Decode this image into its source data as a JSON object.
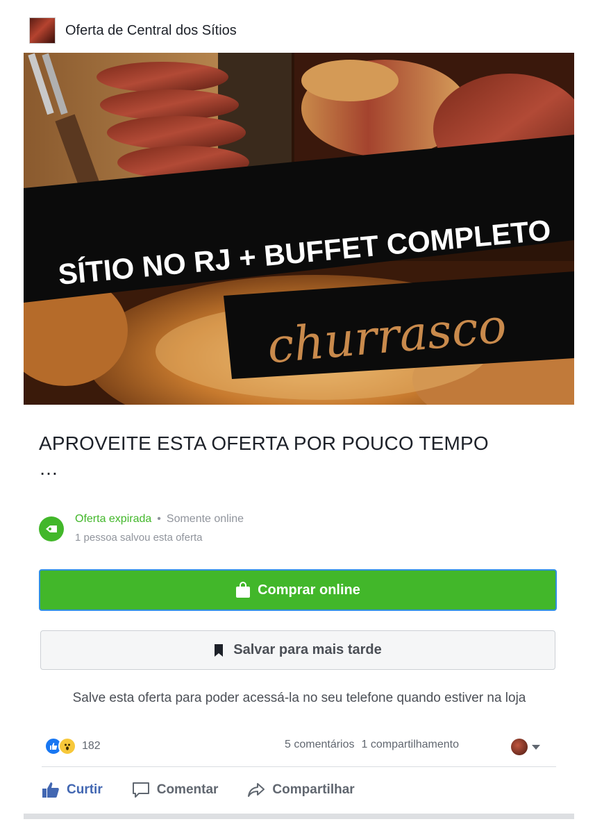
{
  "header": {
    "page_name": "Oferta de Central dos Sítios"
  },
  "hero": {
    "banner_text": "SÍTIO NO RJ + BUFFET COMPLETO",
    "script_text": "churrasco"
  },
  "offer": {
    "title": "APROVEITE ESTA OFERTA POR POUCO TEMPO",
    "title_ellipsis": "…",
    "status_expired": "Oferta expirada",
    "status_dot": "•",
    "status_scope": "Somente online",
    "saved_count": "1 pessoa salvou esta oferta"
  },
  "buttons": {
    "buy_label": "Comprar online",
    "save_label": "Salvar para mais tarde"
  },
  "hint": "Salve esta oferta para poder acessá-la no seu telefone quando estiver na loja",
  "engagement": {
    "reaction_count": "182",
    "comments": "5 comentários",
    "shares": "1 compartilhamento"
  },
  "actions": {
    "like": "Curtir",
    "comment": "Comentar",
    "share": "Compartilhar"
  },
  "colors": {
    "green": "#42b72a",
    "blue": "#4267b2",
    "brand_blue": "#1877f2"
  },
  "icons": [
    "shopping-bag-icon",
    "bookmark-icon",
    "offer-tag-icon",
    "like-icon",
    "wow-icon",
    "comment-icon",
    "share-icon",
    "chevron-down-icon"
  ]
}
